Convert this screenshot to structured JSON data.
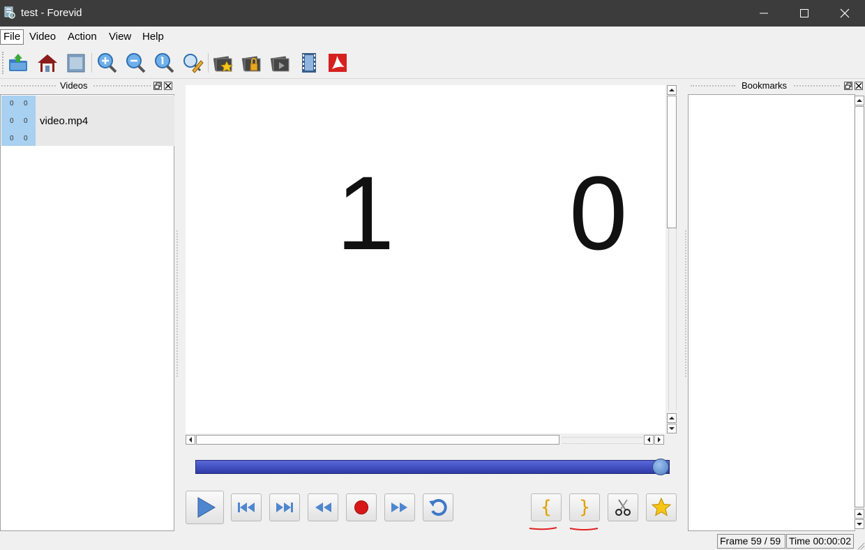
{
  "window": {
    "title": "test - Forevid",
    "icons": [
      "app-icon",
      "minimize-icon",
      "maximize-icon",
      "close-icon"
    ]
  },
  "menu": {
    "file": "File",
    "video": "Video",
    "action": "Action",
    "view": "View",
    "help": "Help"
  },
  "toolbar": {
    "icons": [
      "open-folder-icon",
      "home-icon",
      "window-icon",
      "zoom-in-icon",
      "zoom-out-icon",
      "zoom-reset-icon",
      "zoom-edit-icon",
      "photo-star-icon",
      "photo-lock-icon",
      "photo-arrow-icon",
      "film-icon",
      "pdf-icon"
    ]
  },
  "videos_pane": {
    "title": "Videos",
    "items": [
      {
        "name": "video.mp4",
        "thumb": [
          "0",
          "0",
          "0",
          "0",
          "0",
          "0"
        ]
      }
    ]
  },
  "bookmarks_pane": {
    "title": "Bookmarks"
  },
  "frame_display": {
    "left_digit": "1",
    "right_digit": "0"
  },
  "seek": {
    "position": 1.0
  },
  "playback": {
    "icons": [
      "play-icon",
      "skip-start-icon",
      "skip-end-icon",
      "rewind-icon",
      "record-icon",
      "fast-forward-icon",
      "loop-icon",
      "mark-in-icon",
      "mark-out-icon",
      "cut-icon",
      "bookmark-star-icon"
    ],
    "mark_in_label": "{",
    "mark_out_label": "}"
  },
  "status": {
    "frame": "Frame 59 / 59",
    "time": "Time 00:00:02"
  },
  "colors": {
    "titlebar": "#3c3c3c",
    "seek_fill": "#3a46c0",
    "thumb_bg": "#a8d0f0",
    "annotation": "#e02020"
  }
}
